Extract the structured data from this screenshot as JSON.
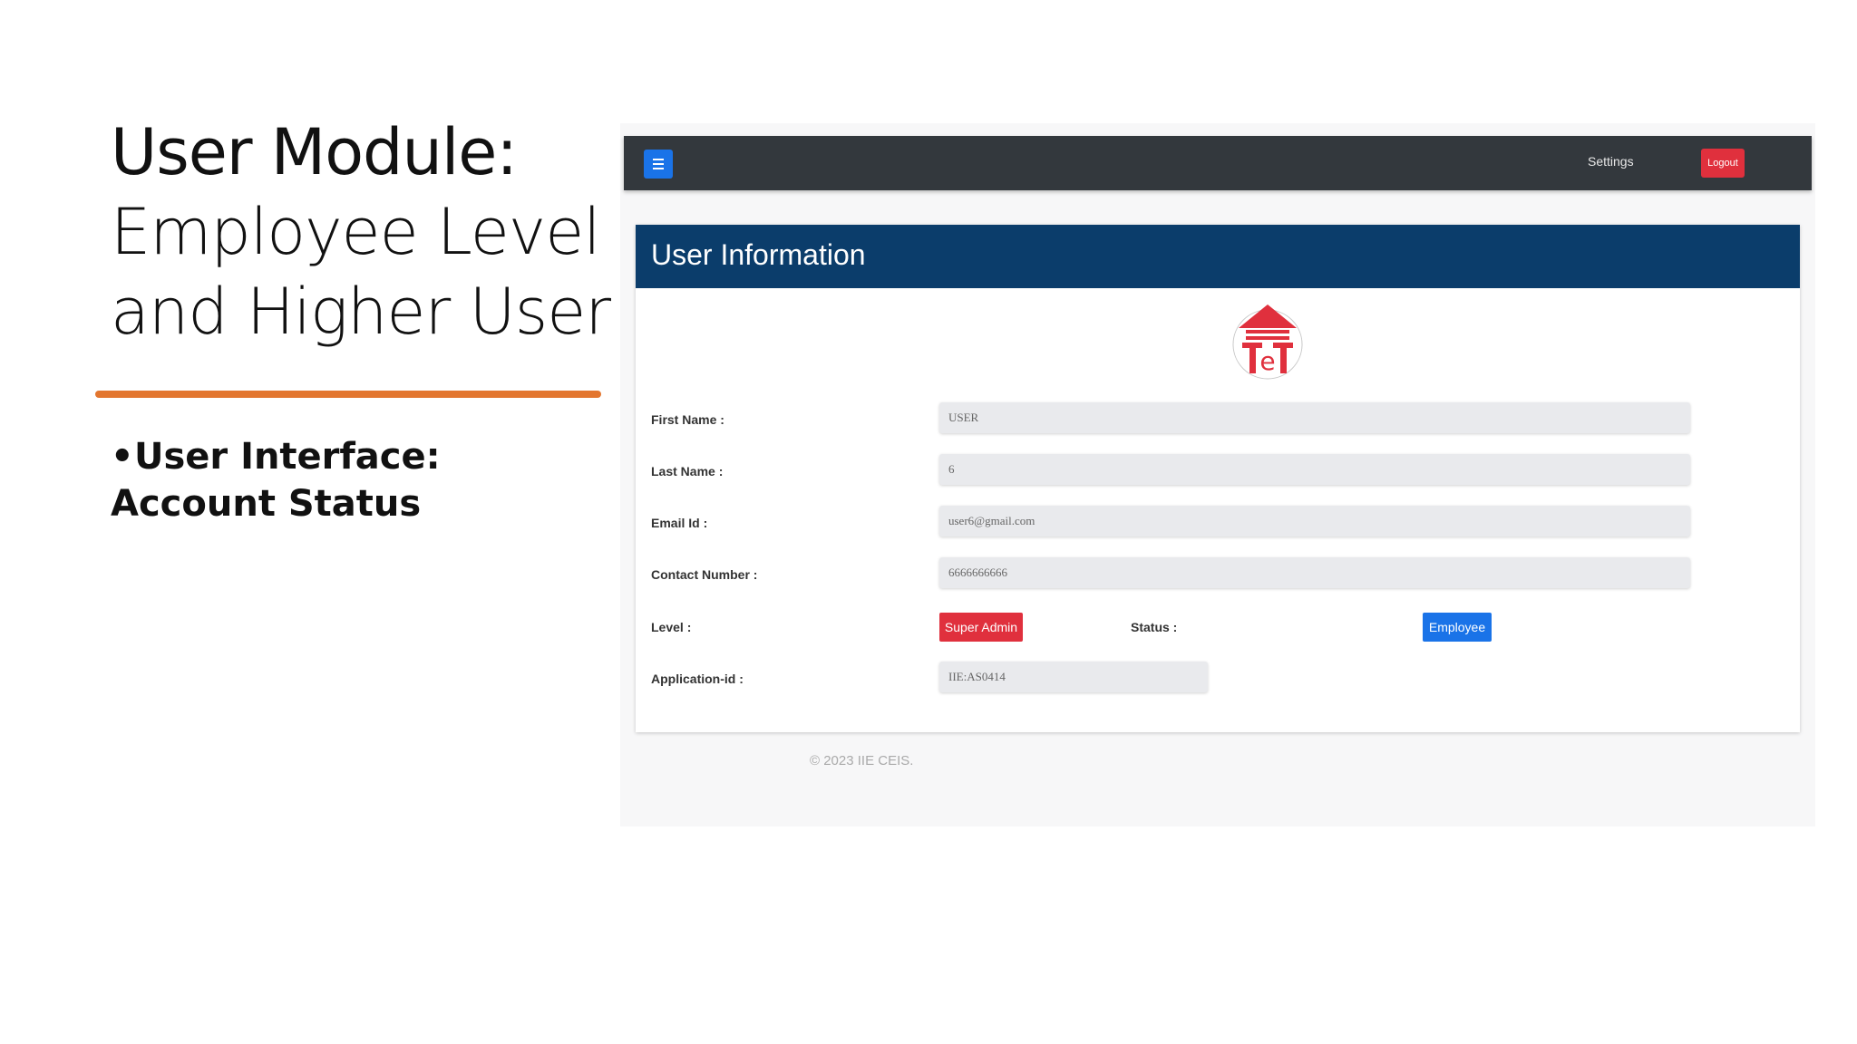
{
  "slide": {
    "title_line1": "User Module:",
    "title_line2": "Employee Level",
    "title_line3": "and Higher User",
    "bullet": "User Interface: Account Status",
    "accent_color": "#e3762f"
  },
  "app": {
    "nav": {
      "menu_icon": "hamburger-menu-icon",
      "settings_label": "Settings",
      "logout_label": "Logout"
    },
    "card": {
      "title": "User Information",
      "logo_icon": "ieit-logo",
      "fields": {
        "first_name": {
          "label": "First Name :",
          "value": "USER"
        },
        "last_name": {
          "label": "Last Name :",
          "value": "6"
        },
        "email": {
          "label": "Email Id :",
          "value": "user6@gmail.com"
        },
        "contact": {
          "label": "Contact Number :",
          "value": "6666666666"
        },
        "level": {
          "label": "Level :",
          "value": "Super Admin"
        },
        "status": {
          "label": "Status :",
          "value": "Employee"
        },
        "application_id": {
          "label": "Application-id :",
          "value": "IIE:AS0414"
        }
      }
    },
    "footer": "© 2023 IIE CEIS.",
    "colors": {
      "topbar": "#33383d",
      "header": "#0b3d6b",
      "danger": "#e0303d",
      "primary": "#1a73e8"
    }
  }
}
